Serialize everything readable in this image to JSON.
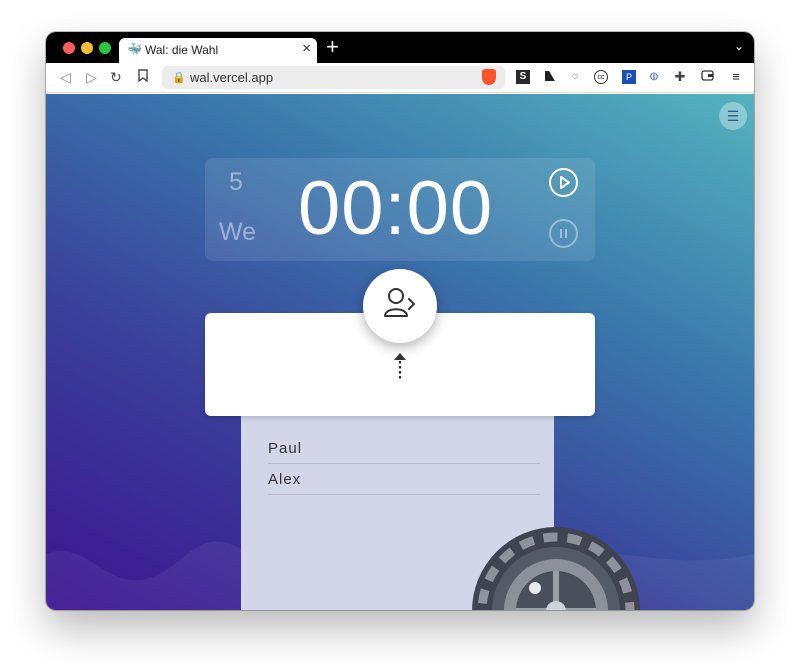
{
  "browser": {
    "tab_title": "Wal: die Wahl",
    "tab_close": "×",
    "new_tab": "+",
    "tab_list": "⌄",
    "url": "wal.vercel.app"
  },
  "icons": {
    "back": "back-arrow-icon",
    "forward": "forward-arrow-icon",
    "reload": "reload-icon",
    "bookmark": "bookmark-icon",
    "lock": "lock-icon",
    "brave": "brave-shield-icon",
    "menu": "hamburger-menu-icon",
    "play": "play-icon",
    "pause": "pause-icon",
    "add_person": "person-next-icon",
    "arrow_up": "dotted-up-arrow-icon"
  },
  "timer": {
    "round_number": "5",
    "round_day": "We",
    "time": "00:00"
  },
  "participants": [
    {
      "name": "Paul"
    },
    {
      "name": "Alex"
    }
  ],
  "colors": {
    "gradient_start": "#3c1591",
    "gradient_end": "#54b3be",
    "list_bg": "#d2d6e8"
  }
}
